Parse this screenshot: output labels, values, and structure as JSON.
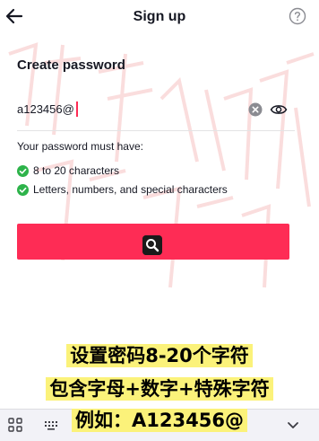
{
  "header": {
    "title": "Sign up",
    "back_icon": "arrow-left-icon",
    "help_icon": "question-circle-icon"
  },
  "form": {
    "section_title": "Create password",
    "password_value": "a123456@",
    "clear_icon": "clear-circle-icon",
    "visibility_icon": "eye-icon"
  },
  "requirements": {
    "title": "Your password must have:",
    "items": [
      {
        "label": "8 to 20 characters",
        "met": true
      },
      {
        "label": "Letters, numbers, and special characters",
        "met": true
      }
    ]
  },
  "next_button": {
    "icon": "search-loader-icon"
  },
  "keyboard_bar": {
    "icons": [
      "grid-icon",
      "keyboard-icon",
      "chevron-down-icon"
    ]
  },
  "captions": [
    "设置密码8-20个字符",
    "包含字母+数字+特殊字符",
    "例如：A123456@"
  ],
  "colors": {
    "accent": "#fe2c55",
    "check": "#2db34a",
    "text": "#161823",
    "caption_bg": "#fbf27a"
  }
}
